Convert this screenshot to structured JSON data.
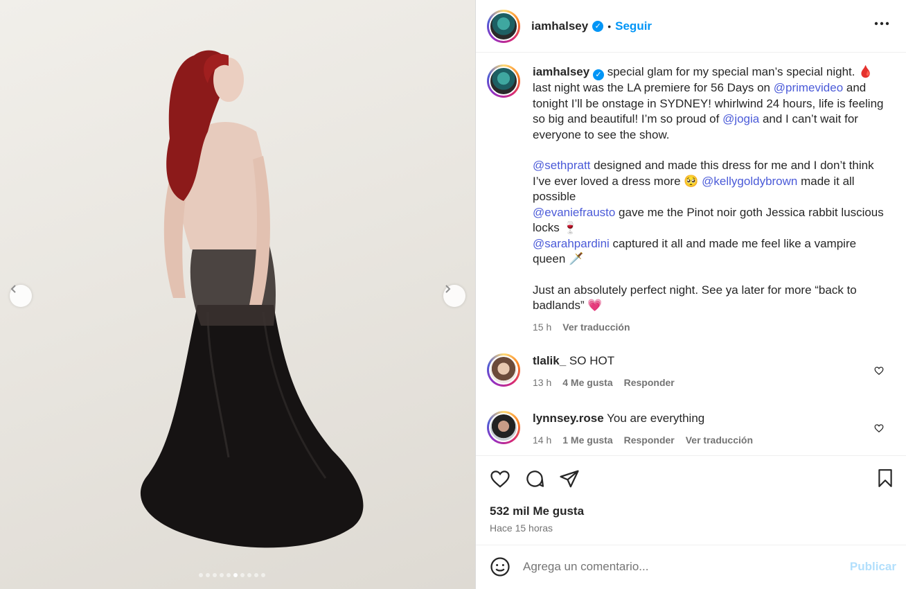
{
  "post": {
    "author": "iamhalsey",
    "follow_label": "Seguir",
    "separator": "•",
    "image_carousel": {
      "total_slides": 10,
      "active_slide": 6
    }
  },
  "caption": {
    "line1_text": " special glam for my special man’s special night. 🩸",
    "line2_pre": "last night was the LA premiere for 56 Days on ",
    "mention_primevideo": "@primevideo",
    "line2_post": " and tonight I’ll be onstage in SYDNEY! whirlwind 24 hours, life is feeling so big and beautiful! I’m so proud of ",
    "mention_jogia": "@jogia",
    "line2_end": " and I can’t wait for everyone to see the show.",
    "mention_sethpratt": "@sethpratt",
    "p2_a": " designed and made this dress for me and I don’t think I’ve ever loved a dress more 🥺 ",
    "mention_kelly": "@kellygoldybrown",
    "p2_b": " made it all possible",
    "mention_evanie": "@evaniefrausto",
    "p2_c": " gave me the Pinot noir goth Jessica rabbit luscious locks 🍷",
    "mention_sarah": "@sarahpardini",
    "p2_d": " captured it all and made me feel like a vampire queen 🗡️",
    "p3": "Just an absolutely perfect night. See ya later for more “back to badlands” 💗",
    "time": "15 h",
    "translate": "Ver traducción"
  },
  "comments": [
    {
      "user": "tlalik_",
      "text": " SO HOT",
      "time": "13 h",
      "likes": "4 Me gusta",
      "reply": "Responder"
    },
    {
      "user": "lynnsey.rose",
      "text": " You are everything",
      "time": "14 h",
      "likes": "1 Me gusta",
      "reply": "Responder",
      "translate": "Ver traducción"
    }
  ],
  "footer": {
    "likes": "532 mil Me gusta",
    "time_ago": "Hace 15 horas",
    "comment_placeholder": "Agrega un comentario...",
    "publish": "Publicar"
  }
}
